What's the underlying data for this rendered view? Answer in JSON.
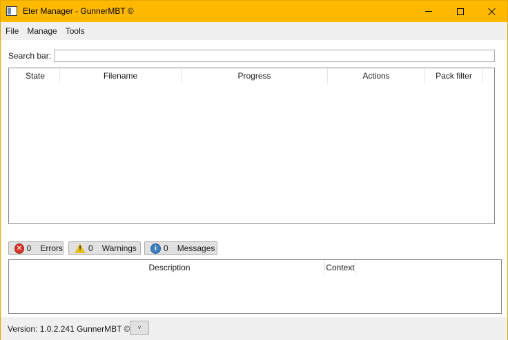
{
  "window": {
    "title": "Eter Manager - GunnerMBT ©",
    "accent_color": "#ffb900"
  },
  "menu": {
    "items": [
      "File",
      "Manage",
      "Tools"
    ]
  },
  "search": {
    "label": "Search bar:",
    "value": "",
    "placeholder": ""
  },
  "file_grid": {
    "columns": [
      "State",
      "Filename",
      "Progress",
      "Actions",
      "Pack filter"
    ],
    "rows": []
  },
  "filters": {
    "errors": {
      "count": "0",
      "label": "Errors",
      "icon": "error-icon"
    },
    "warnings": {
      "count": "0",
      "label": "Warnings",
      "icon": "warning-icon"
    },
    "messages": {
      "count": "0",
      "label": "Messages",
      "icon": "info-icon"
    }
  },
  "message_grid": {
    "columns": [
      "Description",
      "Context"
    ],
    "rows": []
  },
  "status": {
    "version": "Version: 1.0.2.241 GunnerMBT ©",
    "dropdown_glyph": "˅"
  }
}
